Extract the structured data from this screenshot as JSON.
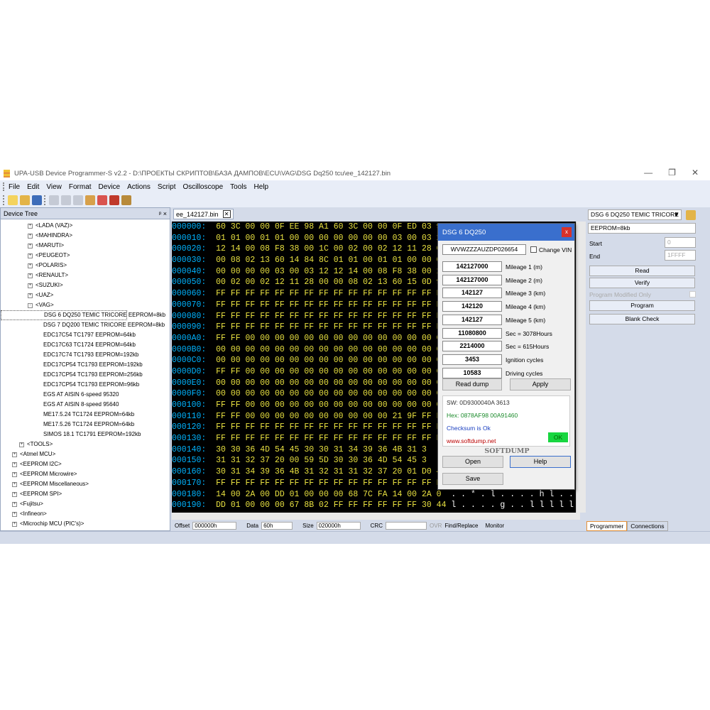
{
  "window": {
    "title": "UPA-USB Device Programmer-S v2.2 - D:\\ПРОЕКТЫ СКРИПТОВ\\БАЗА ДАМПОВ\\ECU\\VAG\\DSG Dq250 tcu\\ee_142127.bin",
    "minimize": "—",
    "restore": "❐",
    "close": "✕"
  },
  "menu": [
    "File",
    "Edit",
    "View",
    "Format",
    "Device",
    "Actions",
    "Script",
    "Oscilloscope",
    "Tools",
    "Help"
  ],
  "device_tree": {
    "title": "Device Tree",
    "pin": "ᵖ",
    "close": "×",
    "items": [
      {
        "label": "<LADA (VAZ)>",
        "level": 2,
        "exp": "+"
      },
      {
        "label": "<MAHINDRA>",
        "level": 2,
        "exp": "+"
      },
      {
        "label": "<MARUTI>",
        "level": 2,
        "exp": "+"
      },
      {
        "label": "<PEUGEOT>",
        "level": 2,
        "exp": "+"
      },
      {
        "label": "<POLARIS>",
        "level": 2,
        "exp": "+"
      },
      {
        "label": "<RENAULT>",
        "level": 2,
        "exp": "+"
      },
      {
        "label": "<SUZUKI>",
        "level": 2,
        "exp": "+"
      },
      {
        "label": "<UAZ>",
        "level": 2,
        "exp": "+"
      },
      {
        "label": "<VAG>",
        "level": 2,
        "exp": "-"
      },
      {
        "label": "DSG 6 DQ250 TEMIC TRICORE EEPROM=8kb",
        "level": 3,
        "exp": "",
        "selected": true
      },
      {
        "label": "DSG 7 DQ200 TEMIC TRICORE EEPROM=8kb",
        "level": 3,
        "exp": ""
      },
      {
        "label": "EDC17C54 TC1797 EEPROM=64kb",
        "level": 3,
        "exp": ""
      },
      {
        "label": "EDC17C63 TC1724 EEPROM=64kb",
        "level": 3,
        "exp": ""
      },
      {
        "label": "EDC17C74 TC1793 EEPROM=192kb",
        "level": 3,
        "exp": ""
      },
      {
        "label": "EDC17CP54 TC1793 EEPROM=192kb",
        "level": 3,
        "exp": ""
      },
      {
        "label": "EDC17CP54 TC1793 EEPROM=256kb",
        "level": 3,
        "exp": ""
      },
      {
        "label": "EDC17CP54 TC1793 EEPROM=96kb",
        "level": 3,
        "exp": ""
      },
      {
        "label": "EGS AT AISIN 6-speed 95320",
        "level": 3,
        "exp": ""
      },
      {
        "label": "EGS AT AISIN 8-speed 95640",
        "level": 3,
        "exp": ""
      },
      {
        "label": "ME17.5.24 TC1724 EEPROM=64kb",
        "level": 3,
        "exp": ""
      },
      {
        "label": "ME17.5.26 TC1724 EEPROM=64kb",
        "level": 3,
        "exp": ""
      },
      {
        "label": "SIMOS 18.1 TC1791 EEPROM=192kb",
        "level": 3,
        "exp": ""
      },
      {
        "label": "<TOOLS>",
        "level": 1,
        "exp": "+"
      },
      {
        "label": "<Atmel MCU>",
        "level": 0,
        "exp": "+"
      },
      {
        "label": "<EEPROM I2C>",
        "level": 0,
        "exp": "+"
      },
      {
        "label": "<EEPROM Microwire>",
        "level": 0,
        "exp": "+"
      },
      {
        "label": "<EEPROM Miscellaneous>",
        "level": 0,
        "exp": "+"
      },
      {
        "label": "<EEPROM SPI>",
        "level": 0,
        "exp": "+"
      },
      {
        "label": "<Fujitsu>",
        "level": 0,
        "exp": "+"
      },
      {
        "label": "<Infineon>",
        "level": 0,
        "exp": "+"
      },
      {
        "label": "<Microchip MCU (PIC's)>",
        "level": 0,
        "exp": "+"
      }
    ]
  },
  "doc_tab": {
    "label": "ee_142127.bin",
    "close": "✕"
  },
  "hex_rows": [
    {
      "off": "000000:",
      "bytes": "60 3C 00 00 0F EE 98 A1 60 3C 00 00 0F ED 03 9"
    },
    {
      "off": "000010:",
      "bytes": "01 01 00 01 01 00 00 00 00 00 00 00 03 00 03 1"
    },
    {
      "off": "000020:",
      "bytes": "12 14 00 08 F8 38 00 1C 00 02 00 02 12 11 28 0"
    },
    {
      "off": "000030:",
      "bytes": "00 08 02 13 60 14 84 8C 01 01 00 01 01 00 00 0"
    },
    {
      "off": "000040:",
      "bytes": "00 00 00 00 03 00 03 12 12 14 00 08 F8 38 00 1"
    },
    {
      "off": "000050:",
      "bytes": "00 02 00 02 12 11 28 00 00 08 02 13 60 15 0D 9"
    },
    {
      "off": "000060:",
      "bytes": "FF FF FF FF FF FF FF FF FF FF FF FF FF FF FF F"
    },
    {
      "off": "000070:",
      "bytes": "FF FF FF FF FF FF FF FF FF FF FF FF FF FF FF F"
    },
    {
      "off": "000080:",
      "bytes": "FF FF FF FF FF FF FF FF FF FF FF FF FF FF FF F"
    },
    {
      "off": "000090:",
      "bytes": "FF FF FF FF FF FF FF FF FF FF FF FF FF FF FF F"
    },
    {
      "off": "0000A0:",
      "bytes": "FF FF 00 00 00 00 00 00 00 00 00 00 00 00 00 0"
    },
    {
      "off": "0000B0:",
      "bytes": "00 00 00 00 00 00 00 00 00 00 00 00 00 00 00 0"
    },
    {
      "off": "0000C0:",
      "bytes": "00 00 00 00 00 00 00 00 00 00 00 00 00 00 00 0"
    },
    {
      "off": "0000D0:",
      "bytes": "FF FF 00 00 00 00 00 00 00 00 00 00 00 00 00 0"
    },
    {
      "off": "0000E0:",
      "bytes": "00 00 00 00 00 00 00 00 00 00 00 00 00 00 00 0"
    },
    {
      "off": "0000F0:",
      "bytes": "00 00 00 00 00 00 00 00 00 00 00 00 00 00 00 0"
    },
    {
      "off": "000100:",
      "bytes": "FF FF 00 00 00 00 00 00 00 00 00 00 00 00 00 0"
    },
    {
      "off": "000110:",
      "bytes": "FF FF 00 00 00 00 00 00 00 00 00 00 21 9F FF F"
    },
    {
      "off": "000120:",
      "bytes": "FF FF FF FF FF FF FF FF FF FF FF FF FF FF FF F"
    },
    {
      "off": "000130:",
      "bytes": "FF FF FF FF FF FF FF FF FF FF FF FF FF FF FF F"
    },
    {
      "off": "000140:",
      "bytes": "30 30 36 4D 54 45 30 30 31 34 39 36 4B 31 3"
    },
    {
      "off": "000150:",
      "bytes": "31 31 32 37 20 00 59 5D 30 30 36 4D 54 45 3"
    },
    {
      "off": "000160:",
      "bytes": "30 31 34 39 36 4B 31 32 31 31 32 37 20 01 D0 4"
    },
    {
      "off": "000170:",
      "bytes": "FF FF FF FF FF FF FF FF FF FF FF FF FF FF FF F"
    },
    {
      "off": "000180:",
      "bytes": "14 00 2A 00 DD 01 00 00 00 68 7C FA 14 00 2A 0",
      "ascii": "  . . * . l . . . . h l . . * ."
    },
    {
      "off": "000190:",
      "bytes": "DD 01 00 00 00 67 8B 02 FF FF FF FF FF FF 30 44",
      "ascii": " l . . . . g . . l l l l l l 0 D"
    }
  ],
  "status": {
    "offset_label": "Offset",
    "offset_value": "000000h",
    "data_label": "Data",
    "data_value": "60h",
    "size_label": "Size",
    "size_value": "020000h",
    "crc_label": "CRC",
    "crc_value": "",
    "ovr": "OVR",
    "find_replace": "Find/Replace",
    "monitor": "Monitor"
  },
  "dialog": {
    "title": "DSG 6 DQ250",
    "close": "x",
    "vin": "WVWZZZAUZDP026654",
    "change_vin": "Change VIN",
    "rows": [
      {
        "value": "142127000",
        "label": "Mileage 1 (m)"
      },
      {
        "value": "142127000",
        "label": "Mileage 2 (m)"
      },
      {
        "value": "142127",
        "label": "Mileage 3 (km)"
      },
      {
        "value": "142120",
        "label": "Mileage 4 (km)"
      },
      {
        "value": "142127",
        "label": "Mileage 5 (km)"
      },
      {
        "value": "11080800",
        "label": "Sec = 3078Hours"
      },
      {
        "value": "2214000",
        "label": "Sec = 615Hours"
      },
      {
        "value": "3453",
        "label": "Ignition cycles"
      },
      {
        "value": "10583",
        "label": "Driving cycles"
      }
    ],
    "read_dump": "Read dump",
    "apply": "Apply",
    "sw": "SW: 0D9300040A  3613",
    "hex": "Hex: 0878AF98 00A91460",
    "checksum": "Checksum is Ok",
    "website": "www.softdump.net",
    "ok": "OK",
    "brand": "SOFTDUMP",
    "open": "Open",
    "help": "Help",
    "save": "Save"
  },
  "right_panel": {
    "device": "DSG 6 DQ250 TEMIC TRICORE",
    "eeprom": "EEPROM=8kb",
    "start_label": "Start",
    "start_value": "0",
    "end_label": "End",
    "end_value": "1FFFF",
    "read": "Read",
    "verify": "Verify",
    "program_modified": "Program Modified Only",
    "program": "Program",
    "blank_check": "Blank Check",
    "tab_programmer": "Programmer",
    "tab_connections": "Connections"
  },
  "colors": {
    "hex_bg": "#000000",
    "hex_offset": "#00b4ff",
    "hex_bytes": "#e8e040",
    "dialog_title": "#3a6fcd",
    "ok_green": "#18d640",
    "checksum_blue": "#1a3fc0",
    "hexline_green": "#1a8a2a"
  }
}
